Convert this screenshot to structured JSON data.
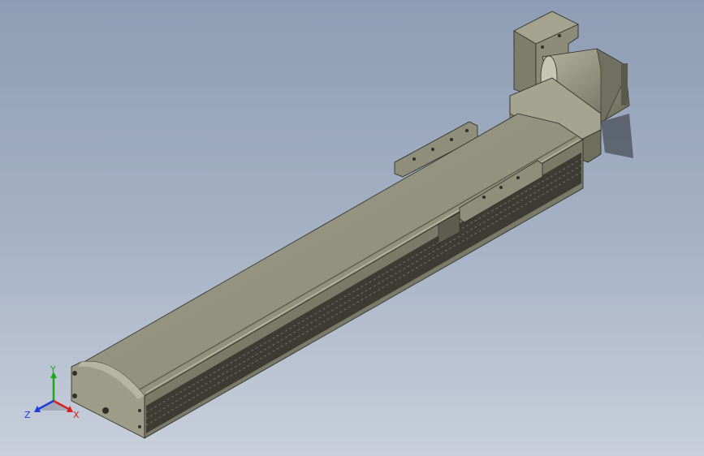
{
  "viewport": {
    "background_top": "#8e9db5",
    "background_bottom": "#c9d0dc"
  },
  "model": {
    "icon": "linear-actuator-model",
    "body_color": "#8f8f7d",
    "shade_color": "#6c6c5c",
    "dark_color": "#3a3a32"
  },
  "triad": {
    "x_label": "X",
    "y_label": "Y",
    "z_label": "Z",
    "x_color": "#d81e1e",
    "y_color": "#1ea81e",
    "z_color": "#1e3ed8"
  }
}
